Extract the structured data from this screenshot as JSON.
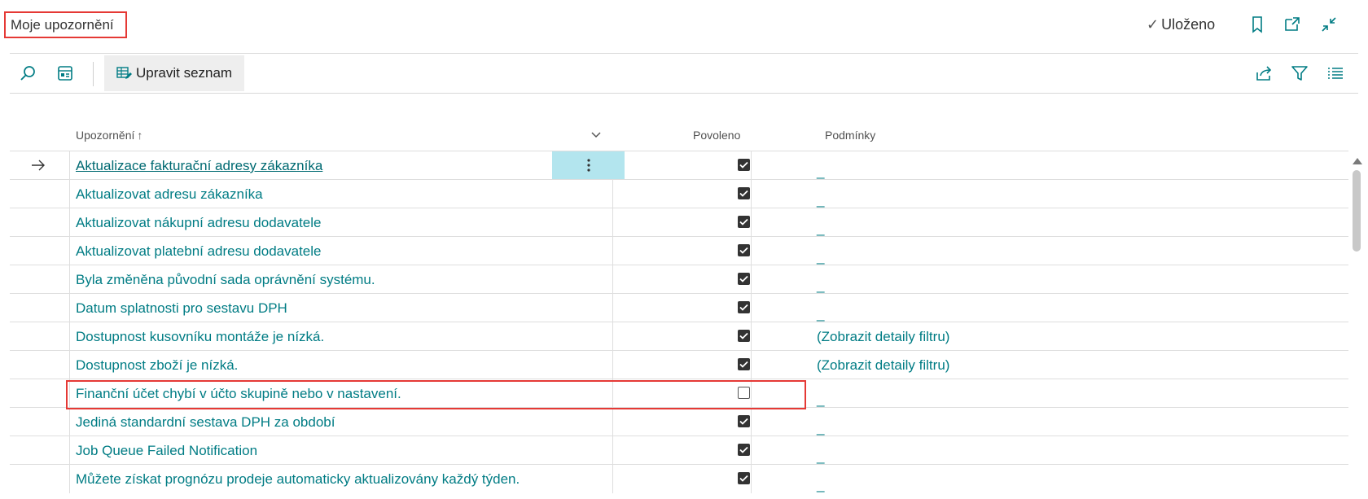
{
  "header": {
    "title": "Moje upozornění",
    "saved_status": "Uloženo",
    "icons": [
      "bookmark-icon",
      "open-new-window-icon",
      "collapse-icon"
    ]
  },
  "toolbar": {
    "search_icon": "search-icon",
    "layout_icon": "show-as-tiles-icon",
    "edit_list_label": "Upravit seznam",
    "right_icons": [
      "share-icon",
      "filter-icon",
      "list-view-icon"
    ]
  },
  "table": {
    "columns": {
      "notification": "Upozornění",
      "enabled": "Povoleno",
      "conditions": "Podmínky"
    },
    "rows": [
      {
        "name": "Aktualizace fakturační adresy zákazníka",
        "enabled": true,
        "conditions": "_"
      },
      {
        "name": "Aktualizovat adresu zákazníka",
        "enabled": true,
        "conditions": "_"
      },
      {
        "name": "Aktualizovat nákupní adresu dodavatele",
        "enabled": true,
        "conditions": "_"
      },
      {
        "name": "Aktualizovat platební adresu dodavatele",
        "enabled": true,
        "conditions": "_"
      },
      {
        "name": "Byla změněna původní sada oprávnění systému.",
        "enabled": true,
        "conditions": "_"
      },
      {
        "name": "Datum splatnosti pro sestavu DPH",
        "enabled": true,
        "conditions": "_"
      },
      {
        "name": "Dostupnost kusovníku montáže je nízká.",
        "enabled": true,
        "conditions": "(Zobrazit detaily filtru)"
      },
      {
        "name": "Dostupnost zboží je nízká.",
        "enabled": true,
        "conditions": "(Zobrazit detaily filtru)"
      },
      {
        "name": "Finanční účet chybí v účto skupině nebo v nastavení.",
        "enabled": false,
        "conditions": "_"
      },
      {
        "name": "Jediná standardní sestava DPH za období",
        "enabled": true,
        "conditions": "_"
      },
      {
        "name": "Job Queue Failed Notification",
        "enabled": true,
        "conditions": "_"
      },
      {
        "name": "Můžete získat prognózu prodeje automaticky aktualizovány každý týden.",
        "enabled": true,
        "conditions": "_"
      }
    ]
  },
  "colors": {
    "accent": "#007c84",
    "highlight": "#e53935",
    "selected_cell": "#b3e5ee"
  }
}
